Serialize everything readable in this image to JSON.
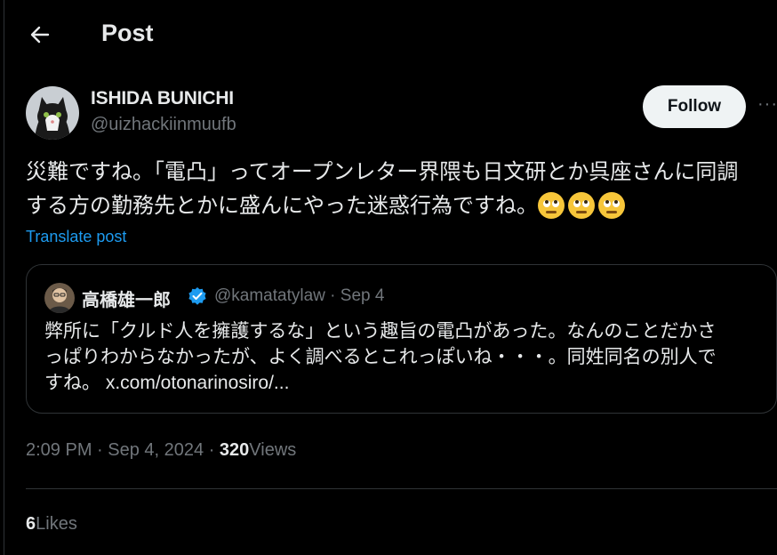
{
  "header": {
    "title": "Post",
    "back_icon": "back-arrow-icon"
  },
  "author": {
    "display_name": "ISHIDA BUNICHI",
    "handle": "@uizhackiinmuufb",
    "follow_label": "Follow",
    "more_label": "···"
  },
  "post": {
    "line1": "災難ですね。「電凸」ってオープンレター界隈も日文研とか呉座さんに同調",
    "line2": "する方の勤務先とかに盛んにやった迷惑行為ですね。",
    "emoji": "face-with-rolling-eyes-icon",
    "translate_label": "Translate post"
  },
  "quote": {
    "name": "高橋雄一郎",
    "verified_icon": "verified-badge-icon",
    "handle": "@kamatatylaw",
    "separator": "·",
    "date": "Sep 4",
    "line1": "弊所に「クルド人を擁護するな」という趣旨の電凸があった。なんのことだかさ",
    "line2": "っぱりわからなかったが、よく調べるとこれっぽいね・・・。同姓同名の別人で",
    "line3": "すね。 x.com/otonarinosiro/..."
  },
  "meta": {
    "time": "2:09 PM",
    "date": "Sep 4, 2024",
    "views_count": "320",
    "views_label": "Views"
  },
  "engagement": {
    "likes_count": "6",
    "likes_label": "Likes"
  },
  "colors": {
    "background": "#000000",
    "text": "#e7e9ea",
    "muted": "#71767b",
    "link": "#1d9bf0",
    "border": "#2f3336"
  }
}
